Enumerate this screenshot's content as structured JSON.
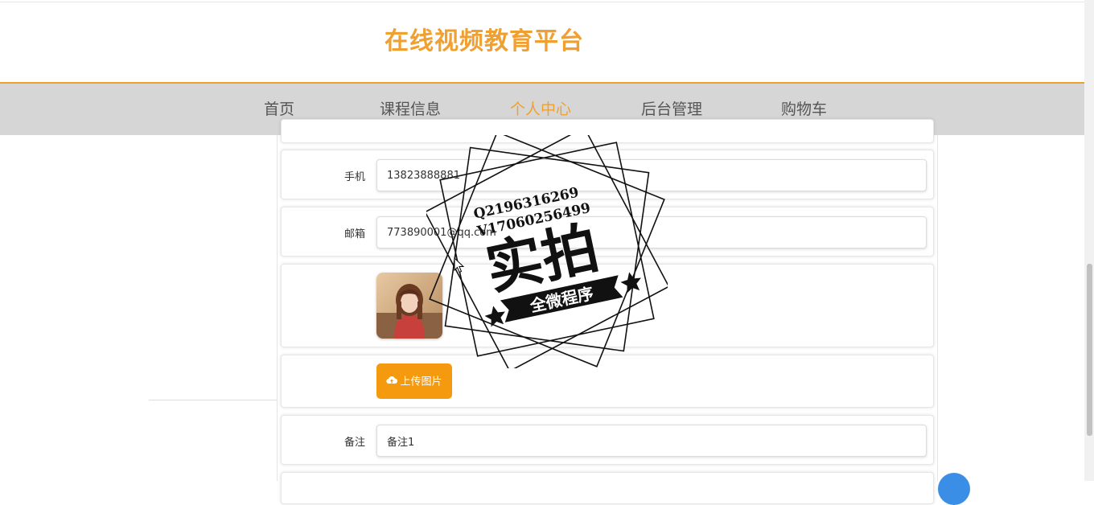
{
  "header": {
    "site_title": "在线视频教育平台"
  },
  "nav": {
    "items": [
      {
        "label": "首页",
        "active": false
      },
      {
        "label": "课程信息",
        "active": false
      },
      {
        "label": "个人中心",
        "active": true
      },
      {
        "label": "后台管理",
        "active": false
      },
      {
        "label": "购物车",
        "active": false
      }
    ]
  },
  "form": {
    "phone": {
      "label": "手机",
      "value": "13823888881"
    },
    "email": {
      "label": "邮箱",
      "value": "773890001@qq.com"
    },
    "upload_button": "上传图片",
    "remark": {
      "label": "备注",
      "value": "备注1"
    }
  },
  "watermark": {
    "contact_q": "Q2196316269",
    "contact_v": "V17060256499",
    "main_text": "实拍",
    "banner_text": "全微程序"
  },
  "colors": {
    "accent": "#f0a030",
    "button": "#f59a0f",
    "nav_bg": "#d6d6d6"
  }
}
